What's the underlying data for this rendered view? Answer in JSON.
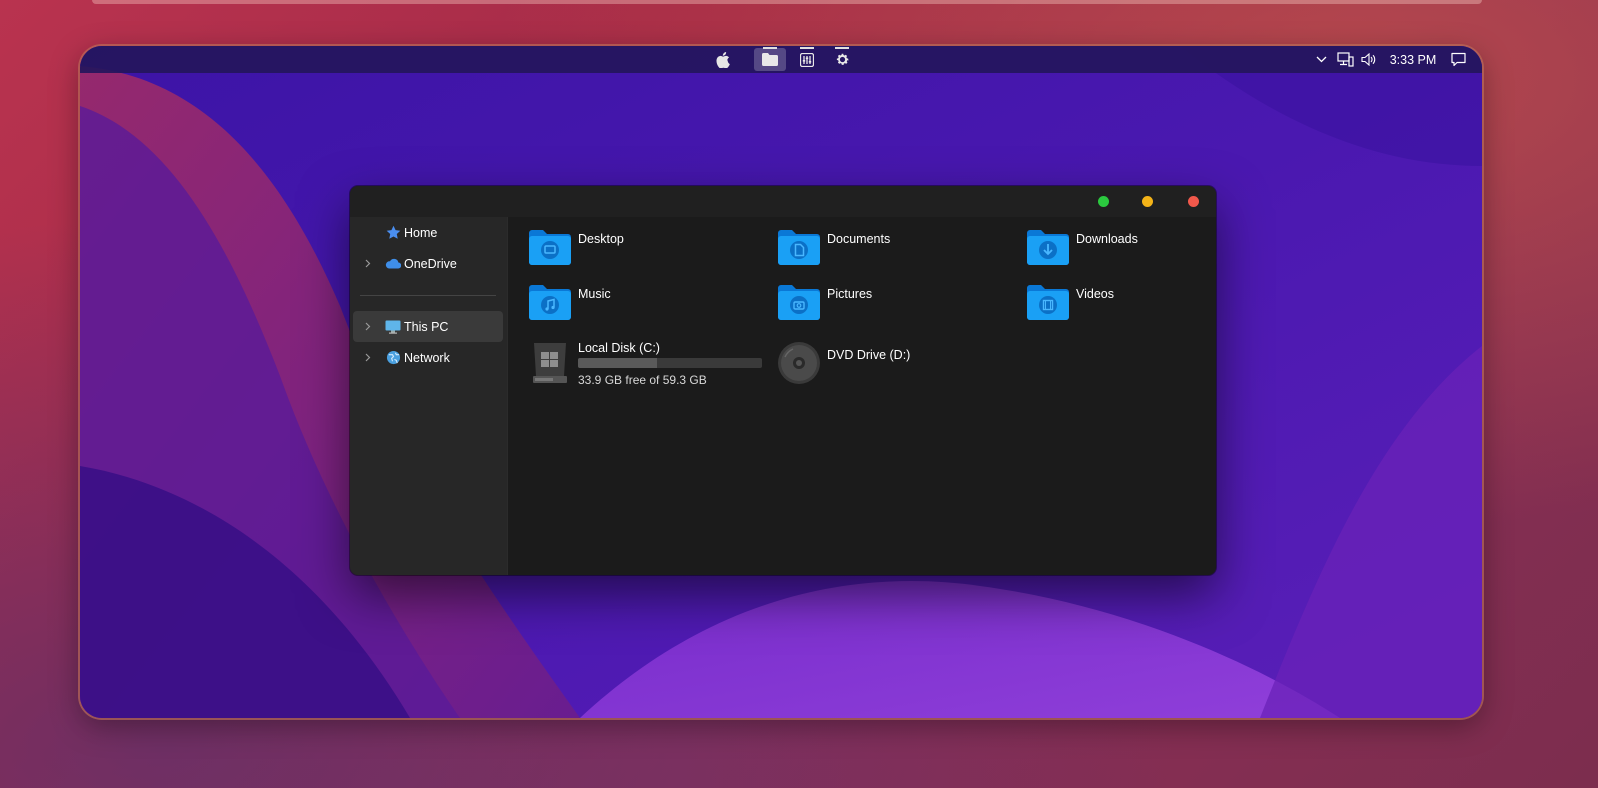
{
  "menubar": {
    "center_icons": [
      {
        "name": "apple-logo-icon"
      },
      {
        "name": "file-explorer-icon",
        "active": true
      },
      {
        "name": "control-panel-icon"
      },
      {
        "name": "settings-gear-icon"
      }
    ],
    "tray": {
      "clock": "3:33 PM"
    }
  },
  "window": {
    "controls": [
      {
        "name": "maximize",
        "color": "#2bc93f"
      },
      {
        "name": "minimize",
        "color": "#f3b318"
      },
      {
        "name": "close",
        "color": "#f1584b"
      }
    ]
  },
  "sidebar": {
    "items": [
      {
        "label": "Home",
        "icon": "star-icon",
        "expandable": false
      },
      {
        "label": "OneDrive",
        "icon": "cloud-icon",
        "expandable": true
      },
      {
        "label": "This PC",
        "icon": "monitor-icon",
        "expandable": true,
        "selected": true
      },
      {
        "label": "Network",
        "icon": "network-globe-icon",
        "expandable": true
      }
    ]
  },
  "content": {
    "folders": [
      {
        "label": "Desktop",
        "glyph": "desktop"
      },
      {
        "label": "Documents",
        "glyph": "document"
      },
      {
        "label": "Downloads",
        "glyph": "download"
      },
      {
        "label": "Music",
        "glyph": "music"
      },
      {
        "label": "Pictures",
        "glyph": "camera"
      },
      {
        "label": "Videos",
        "glyph": "film"
      }
    ],
    "drives": [
      {
        "label": "Local Disk (C:)",
        "free_text": "33.9 GB free of 59.3 GB",
        "used_fraction": 0.428,
        "icon": "hard-disk-icon"
      },
      {
        "label": "DVD Drive (D:)",
        "icon": "dvd-disc-icon"
      }
    ]
  },
  "colors": {
    "folder_blue": "#1aa0f5",
    "folder_blue_dark": "#0a78d6",
    "accent": "#2bc93f"
  }
}
